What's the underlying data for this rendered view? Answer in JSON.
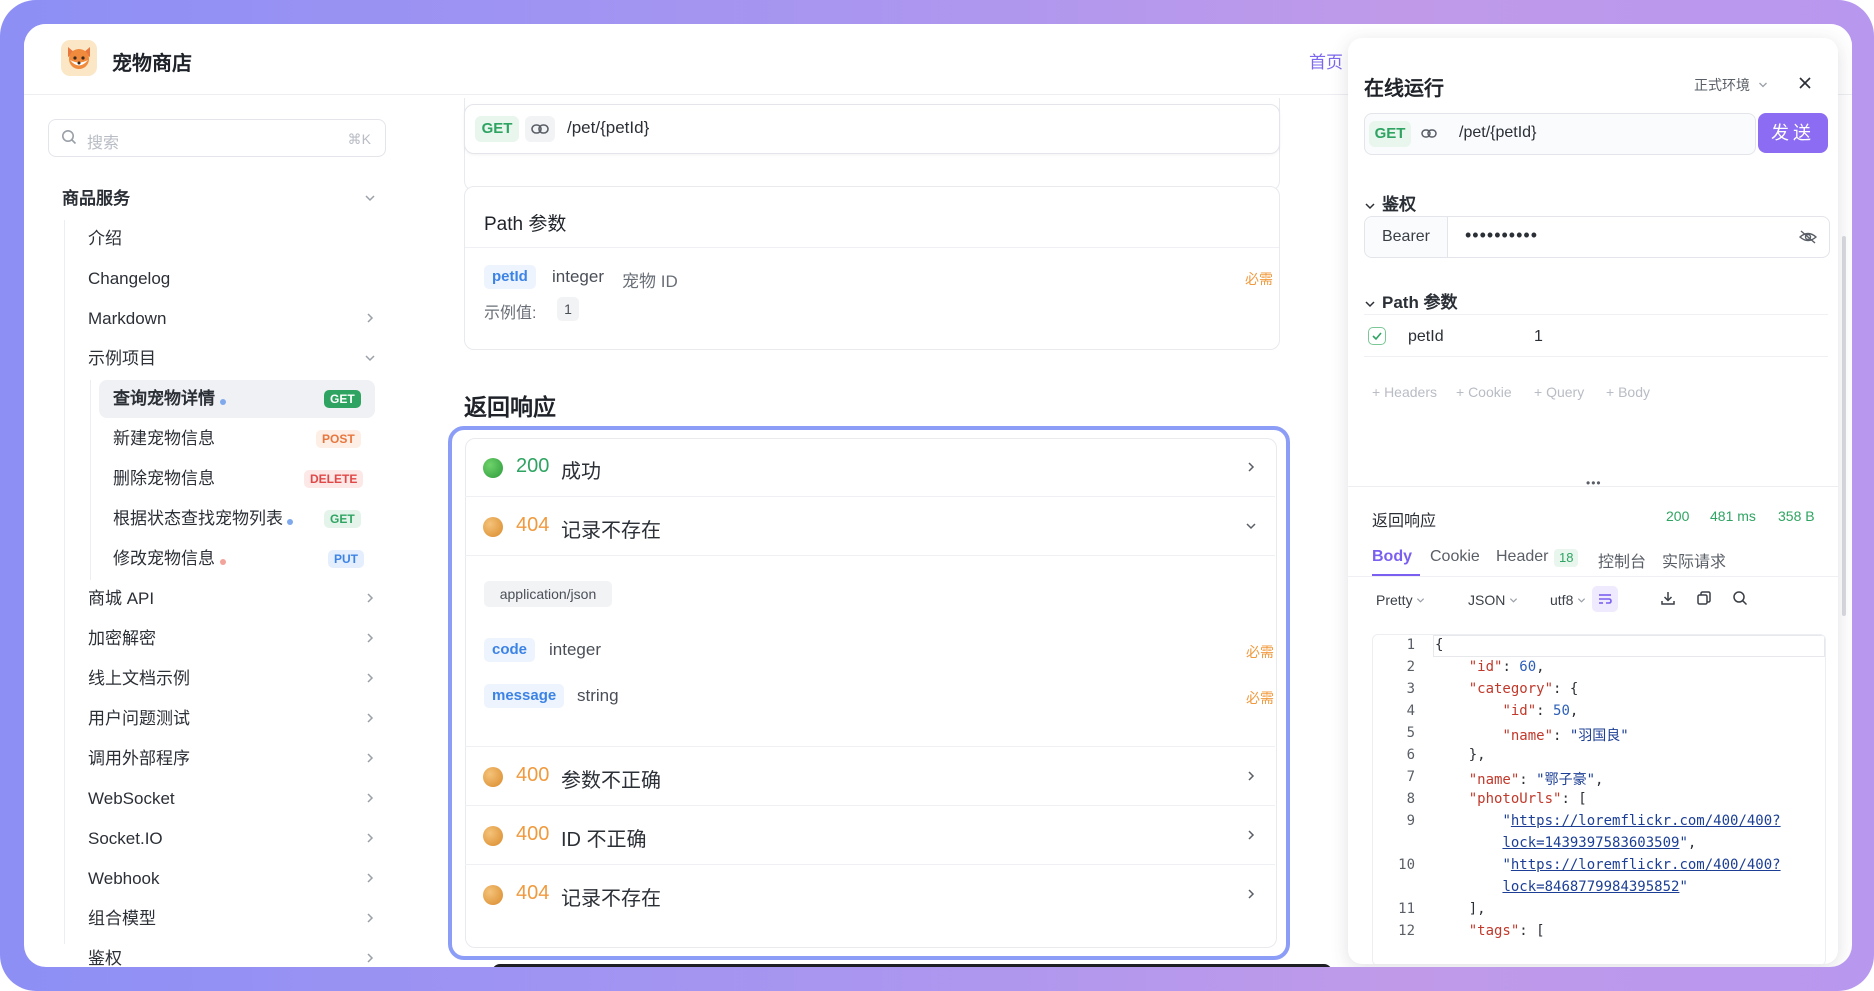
{
  "header": {
    "brand": "宠物商店",
    "nav_home": "首页"
  },
  "search": {
    "placeholder": "搜索",
    "shortcut": "⌘K"
  },
  "sidebar": {
    "group": "商品服务",
    "items": [
      "介绍",
      "Changelog",
      "Markdown",
      "示例项目"
    ],
    "sub_items": [
      {
        "label": "查询宠物详情",
        "method": "GET"
      },
      {
        "label": "新建宠物信息",
        "method": "POST"
      },
      {
        "label": "删除宠物信息",
        "method": "DELETE"
      },
      {
        "label": "根据状态查找宠物列表",
        "method": "GET"
      },
      {
        "label": "修改宠物信息",
        "method": "PUT"
      }
    ],
    "more_items": [
      "商城 API",
      "加密解密",
      "线上文档示例",
      "用户问题测试",
      "调用外部程序",
      "WebSocket",
      "Socket.IO",
      "Webhook",
      "组合模型",
      "鉴权"
    ]
  },
  "endpoint": {
    "method": "GET",
    "path": "/pet/{petId}"
  },
  "path_params": {
    "title": "Path 参数",
    "name": "petId",
    "type": "integer",
    "desc": "宠物 ID",
    "required": "必需",
    "example_label": "示例值:",
    "example_value": "1"
  },
  "responses": {
    "title": "返回响应",
    "r1": {
      "code": "200",
      "text": "成功"
    },
    "r2": {
      "code": "404",
      "text": "记录不存在"
    },
    "content_type": "application/json",
    "fields": [
      {
        "name": "code",
        "type": "integer",
        "required": "必需"
      },
      {
        "name": "message",
        "type": "string",
        "required": "必需"
      }
    ],
    "r3": {
      "code": "400",
      "text": "参数不正确"
    },
    "r4": {
      "code": "400",
      "text": "ID 不正确"
    },
    "r5": {
      "code": "404",
      "text": "记录不存在"
    }
  },
  "panel": {
    "title": "在线运行",
    "env": "正式环境",
    "method": "GET",
    "path": "/pet/{petId}",
    "send": "发送",
    "auth_title": "鉴权",
    "auth_type": "Bearer",
    "auth_value": "••••••••••",
    "path_title": "Path 参数",
    "param_name": "petId",
    "param_value": "1",
    "add_headers": "+ Headers",
    "add_cookie": "+ Cookie",
    "add_query": "+ Query",
    "add_body": "+ Body",
    "resp_title": "返回响应",
    "status": "200",
    "time": "481 ms",
    "size": "358 B",
    "tabs": {
      "body": "Body",
      "cookie": "Cookie",
      "header": "Header",
      "header_count": "18",
      "console": "控制台",
      "actual": "实际请求"
    },
    "toolbar": {
      "pretty": "Pretty",
      "format": "JSON",
      "encoding": "utf8"
    }
  },
  "code_lines": {
    "l1": "{",
    "l2k": "\"id\"",
    "l2v": "60",
    "l3k": "\"category\"",
    "l4k": "\"id\"",
    "l4v": "50",
    "l5k": "\"name\"",
    "l5v": "\"羽国良\"",
    "l6": "},",
    "l7k": "\"name\"",
    "l7v": "\"鄂子豪\"",
    "l8k": "\"photoUrls\"",
    "l9a": "https://loremflickr.com/400/400?",
    "l9b": "lock=1439397583603509",
    "l10a": "https://loremflickr.com/400/400?",
    "l10b": "lock=8468779984395852",
    "l11": "],",
    "l12k": "\"tags\""
  },
  "colors": {
    "accent": "#7b5ff0",
    "success": "#2fa462",
    "warning": "#f09a3e"
  }
}
